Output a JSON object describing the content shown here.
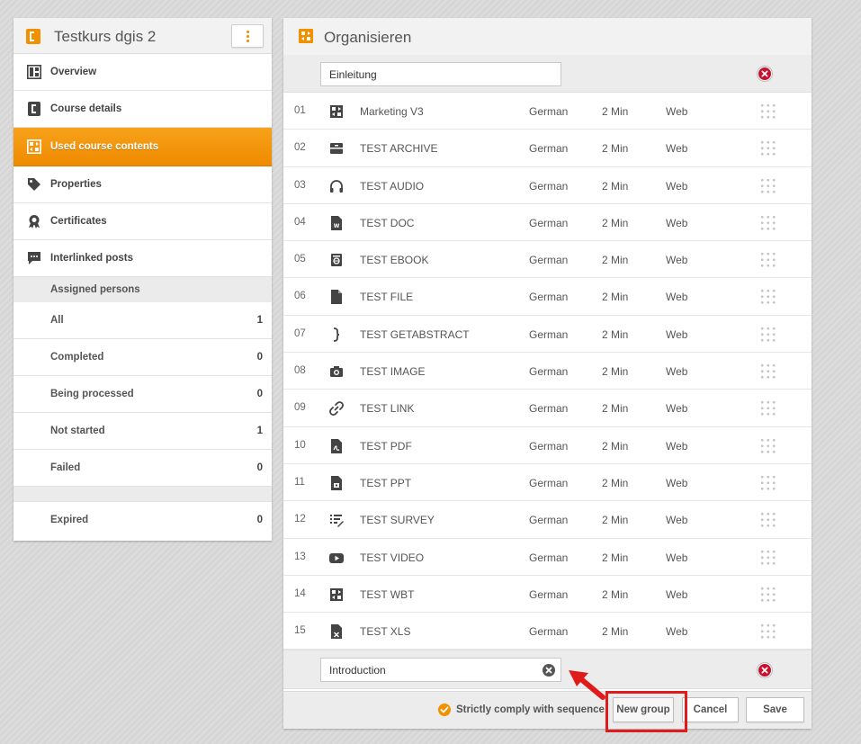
{
  "sidebar": {
    "course_title": "Testkurs dgis 2",
    "nav": [
      {
        "label": "Overview",
        "icon": "overview-icon"
      },
      {
        "label": "Course details",
        "icon": "course-details-icon"
      },
      {
        "label": "Used course contents",
        "icon": "course-contents-icon",
        "active": true
      },
      {
        "label": "Properties",
        "icon": "tag-icon"
      },
      {
        "label": "Certificates",
        "icon": "certificate-icon"
      },
      {
        "label": "Interlinked posts",
        "icon": "chat-icon"
      }
    ],
    "assigned_heading": "Assigned persons",
    "stats": [
      {
        "label": "All",
        "count": "1"
      },
      {
        "label": "Completed",
        "count": "0"
      },
      {
        "label": "Being processed",
        "count": "0"
      },
      {
        "label": "Not started",
        "count": "1"
      },
      {
        "label": "Failed",
        "count": "0"
      }
    ],
    "expired": {
      "label": "Expired",
      "count": "0"
    }
  },
  "main": {
    "title": "Organisieren",
    "group1_name": "Einleitung",
    "group2_name": "Introduction",
    "rows": [
      {
        "num": "01",
        "name": "Marketing V3",
        "lang": "German",
        "dur": "2 Min",
        "plat": "Web",
        "icon": "wbt-icon"
      },
      {
        "num": "02",
        "name": "TEST ARCHIVE",
        "lang": "German",
        "dur": "2 Min",
        "plat": "Web",
        "icon": "archive-icon"
      },
      {
        "num": "03",
        "name": "TEST AUDIO",
        "lang": "German",
        "dur": "2 Min",
        "plat": "Web",
        "icon": "headphones-icon"
      },
      {
        "num": "04",
        "name": "TEST DOC",
        "lang": "German",
        "dur": "2 Min",
        "plat": "Web",
        "icon": "doc-icon"
      },
      {
        "num": "05",
        "name": "TEST EBOOK",
        "lang": "German",
        "dur": "2 Min",
        "plat": "Web",
        "icon": "ebook-icon"
      },
      {
        "num": "06",
        "name": "TEST FILE",
        "lang": "German",
        "dur": "2 Min",
        "plat": "Web",
        "icon": "file-icon"
      },
      {
        "num": "07",
        "name": "TEST GETABSTRACT",
        "lang": "German",
        "dur": "2 Min",
        "plat": "Web",
        "icon": "brace-icon"
      },
      {
        "num": "08",
        "name": "TEST IMAGE",
        "lang": "German",
        "dur": "2 Min",
        "plat": "Web",
        "icon": "camera-icon"
      },
      {
        "num": "09",
        "name": "TEST LINK",
        "lang": "German",
        "dur": "2 Min",
        "plat": "Web",
        "icon": "link-icon"
      },
      {
        "num": "10",
        "name": "TEST PDF",
        "lang": "German",
        "dur": "2 Min",
        "plat": "Web",
        "icon": "pdf-icon"
      },
      {
        "num": "11",
        "name": "TEST PPT",
        "lang": "German",
        "dur": "2 Min",
        "plat": "Web",
        "icon": "ppt-icon"
      },
      {
        "num": "12",
        "name": "TEST SURVEY",
        "lang": "German",
        "dur": "2 Min",
        "plat": "Web",
        "icon": "survey-icon"
      },
      {
        "num": "13",
        "name": "TEST VIDEO",
        "lang": "German",
        "dur": "2 Min",
        "plat": "Web",
        "icon": "video-icon"
      },
      {
        "num": "14",
        "name": "TEST WBT",
        "lang": "German",
        "dur": "2 Min",
        "plat": "Web",
        "icon": "wbt-icon"
      },
      {
        "num": "15",
        "name": "TEST XLS",
        "lang": "German",
        "dur": "2 Min",
        "plat": "Web",
        "icon": "xls-icon"
      }
    ],
    "footer": {
      "strict_label": "Strictly comply with sequence",
      "new_group": "New group",
      "cancel": "Cancel",
      "save": "Save"
    }
  },
  "colors": {
    "accent": "#f29100",
    "remove": "#c8102e",
    "highlight": "#e01b1b"
  }
}
